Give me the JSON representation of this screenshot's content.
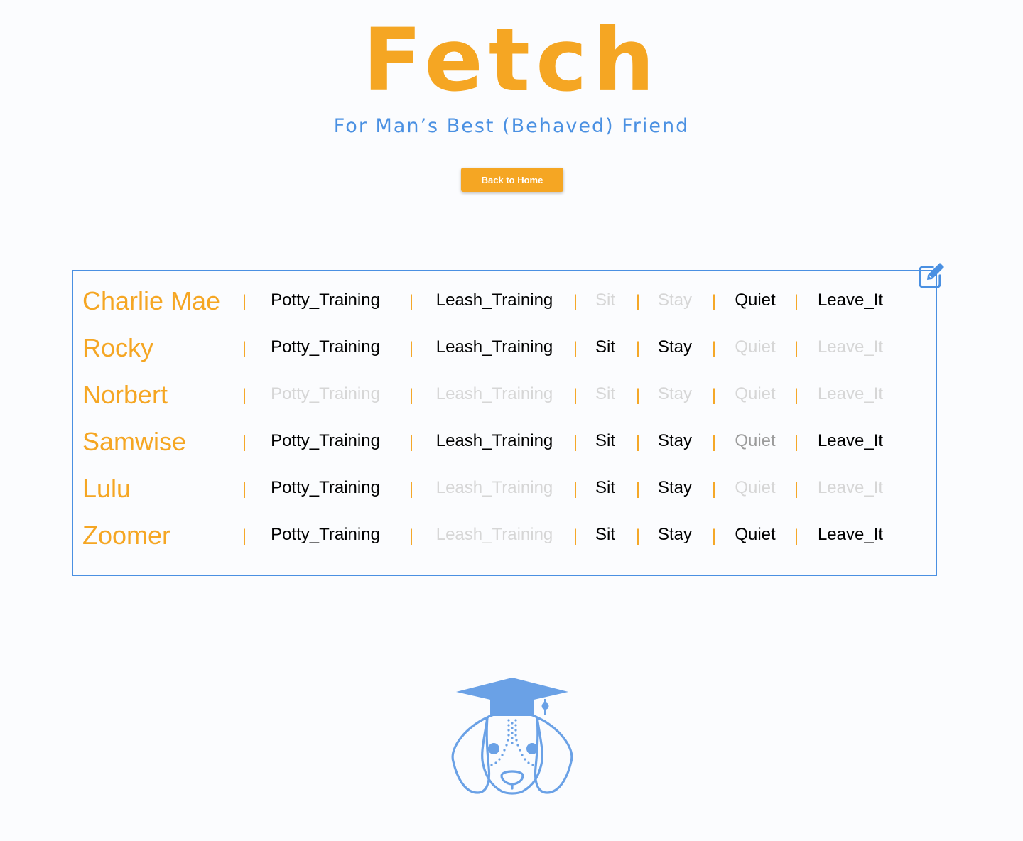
{
  "header": {
    "title": "Fetch",
    "tagline": "For Man’s Best (Behaved) Friend",
    "home_button_label": "Back to Home"
  },
  "colors": {
    "brand_orange": "#f5a623",
    "brand_blue": "#4a90e2",
    "skill_done": "#000000",
    "skill_partial": "#9b9b9b",
    "skill_todo": "#d6d6d6"
  },
  "separator": "|",
  "dogs": [
    {
      "name": "Charlie Mae",
      "skills": [
        {
          "label": "Potty_Training",
          "status": "done"
        },
        {
          "label": "Leash_Training",
          "status": "done"
        },
        {
          "label": "Sit",
          "status": "todo"
        },
        {
          "label": "Stay",
          "status": "todo"
        },
        {
          "label": "Quiet",
          "status": "done"
        },
        {
          "label": "Leave_It",
          "status": "done"
        }
      ]
    },
    {
      "name": "Rocky",
      "skills": [
        {
          "label": "Potty_Training",
          "status": "done"
        },
        {
          "label": "Leash_Training",
          "status": "done"
        },
        {
          "label": "Sit",
          "status": "done"
        },
        {
          "label": "Stay",
          "status": "done"
        },
        {
          "label": "Quiet",
          "status": "todo"
        },
        {
          "label": "Leave_It",
          "status": "todo"
        }
      ]
    },
    {
      "name": "Norbert",
      "skills": [
        {
          "label": "Potty_Training",
          "status": "todo"
        },
        {
          "label": "Leash_Training",
          "status": "todo"
        },
        {
          "label": "Sit",
          "status": "todo"
        },
        {
          "label": "Stay",
          "status": "todo"
        },
        {
          "label": "Quiet",
          "status": "todo"
        },
        {
          "label": "Leave_It",
          "status": "todo"
        }
      ]
    },
    {
      "name": "Samwise",
      "skills": [
        {
          "label": "Potty_Training",
          "status": "done"
        },
        {
          "label": "Leash_Training",
          "status": "done"
        },
        {
          "label": "Sit",
          "status": "done"
        },
        {
          "label": "Stay",
          "status": "done"
        },
        {
          "label": "Quiet",
          "status": "partial"
        },
        {
          "label": "Leave_It",
          "status": "done"
        }
      ]
    },
    {
      "name": "Lulu",
      "skills": [
        {
          "label": "Potty_Training",
          "status": "done"
        },
        {
          "label": "Leash_Training",
          "status": "todo"
        },
        {
          "label": "Sit",
          "status": "done"
        },
        {
          "label": "Stay",
          "status": "done"
        },
        {
          "label": "Quiet",
          "status": "todo"
        },
        {
          "label": "Leave_It",
          "status": "todo"
        }
      ]
    },
    {
      "name": "Zoomer",
      "skills": [
        {
          "label": "Potty_Training",
          "status": "done"
        },
        {
          "label": "Leash_Training",
          "status": "todo"
        },
        {
          "label": "Sit",
          "status": "done"
        },
        {
          "label": "Stay",
          "status": "done"
        },
        {
          "label": "Quiet",
          "status": "done"
        },
        {
          "label": "Leave_It",
          "status": "done"
        }
      ]
    }
  ],
  "icons": {
    "edit": "edit-icon",
    "mascot": "graduate-dog-icon"
  }
}
